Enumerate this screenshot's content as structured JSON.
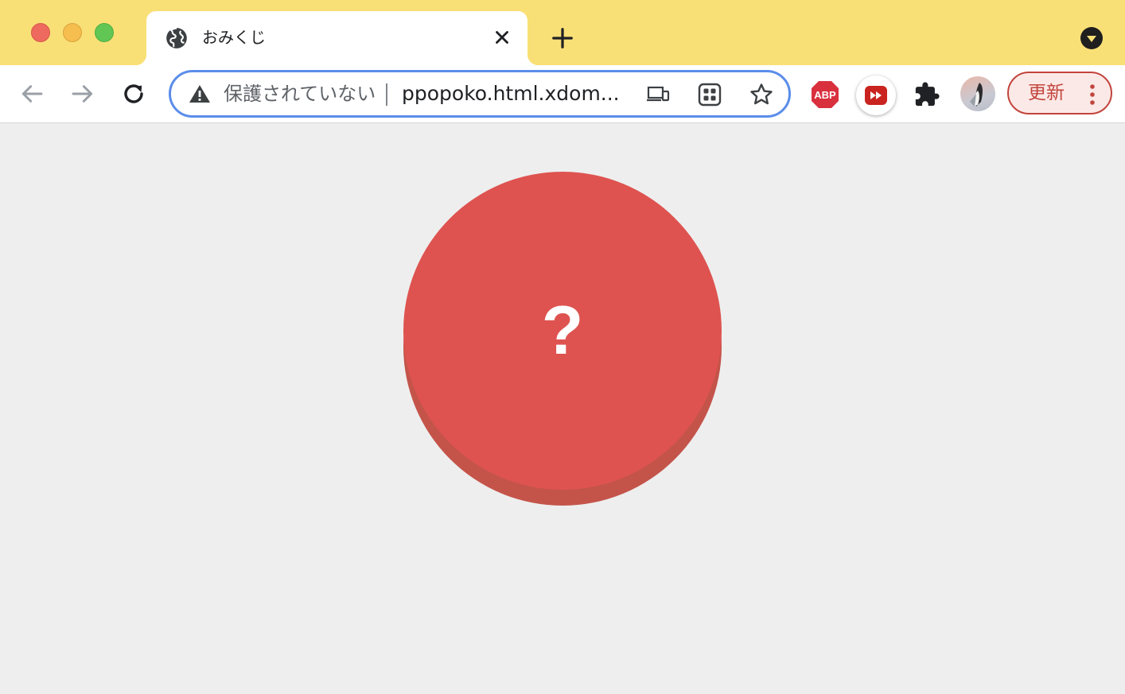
{
  "window": {
    "traffic_lights": [
      "close",
      "minimize",
      "zoom"
    ]
  },
  "tab": {
    "title": "おみくじ",
    "favicon": "globe-icon",
    "close_icon": "close-icon"
  },
  "toolbar": {
    "back_icon": "back-arrow-icon",
    "forward_icon": "forward-arrow-icon",
    "reload_icon": "reload-icon",
    "omnibox": {
      "security_label": "保護されていない",
      "url": "ppopoko.html.xdom..."
    },
    "update_label": "更新"
  },
  "page": {
    "button_symbol": "?",
    "colors": {
      "button_face": "#de5350",
      "button_side": "#c4544a",
      "background": "#eeeeee"
    }
  },
  "colors": {
    "titlebar": "#f9e076",
    "omnibox_focus": "#5b8dea",
    "update_accent": "#c2443c"
  }
}
